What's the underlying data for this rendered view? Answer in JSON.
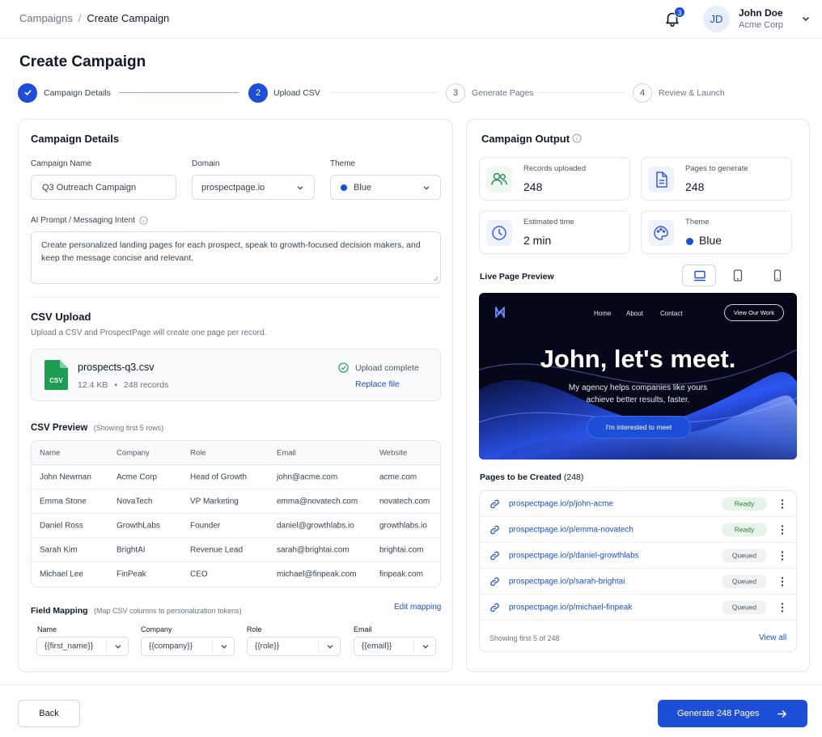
{
  "breadcrumb": {
    "parent": "Campaigns",
    "separator": "/",
    "current": "Create Campaign"
  },
  "header": {
    "notification_count": "3",
    "user_initials": "JD",
    "user_name": "John Doe",
    "user_org": "Acme Corp"
  },
  "page_title": "Create Campaign",
  "stepper": [
    {
      "number": "1",
      "label": "Campaign Details",
      "state": "done"
    },
    {
      "number": "2",
      "label": "Upload CSV",
      "state": "active"
    },
    {
      "number": "3",
      "label": "Generate Pages",
      "state": "todo"
    },
    {
      "number": "4",
      "label": "Review & Launch",
      "state": "todo"
    }
  ],
  "campaign_details": {
    "heading": "Campaign Details",
    "name_label": "Campaign Name",
    "name_value": "Q3 Outreach Campaign",
    "domain_label": "Domain",
    "domain_value": "prospectpage.io",
    "theme_label": "Theme",
    "theme_value": "Blue",
    "prompt_label": "AI Prompt / Messaging Intent",
    "prompt_value": "Create personalized landing pages for each prospect, speak to growth-focused decision makers, and keep the message concise and relevant."
  },
  "csv_upload": {
    "heading": "CSV Upload",
    "description": "Upload a CSV and ProspectPage will create one page per record.",
    "file_badge": "CSV",
    "file_name": "prospects-q3.csv",
    "file_size": "12.4 KB",
    "bullet": "•",
    "record_count": "248 records",
    "status": "Upload complete",
    "replace_label": "Replace file"
  },
  "csv_preview": {
    "heading": "CSV Preview",
    "note": "(Showing first 5 rows)",
    "columns": [
      "Name",
      "Company",
      "Role",
      "Email",
      "Website"
    ],
    "rows": [
      [
        "John Newman",
        "Acme Corp",
        "Head of Growth",
        "john@acme.com",
        "acme.com"
      ],
      [
        "Emma Stone",
        "NovaTech",
        "VP Marketing",
        "emma@novatech.com",
        "novatech.com"
      ],
      [
        "Daniel Ross",
        "GrowthLabs",
        "Founder",
        "daniel@growthlabs.io",
        "growthlabs.io"
      ],
      [
        "Sarah Kim",
        "BrightAI",
        "Revenue Lead",
        "sarah@brightai.com",
        "brightai.com"
      ],
      [
        "Michael Lee",
        "FinPeak",
        "CEO",
        "michael@finpeak.com",
        "finpeak.com"
      ]
    ]
  },
  "field_mapping": {
    "heading": "Field Mapping",
    "note": "(Map CSV columns to personalization tokens)",
    "edit_label": "Edit mapping",
    "fields": [
      {
        "label": "Name",
        "value": "{{first_name}}"
      },
      {
        "label": "Company",
        "value": "{{company}}"
      },
      {
        "label": "Role",
        "value": "{{role}}"
      },
      {
        "label": "Email",
        "value": "{{email}}"
      }
    ]
  },
  "output": {
    "heading": "Campaign Output",
    "stats": [
      {
        "label": "Records uploaded",
        "value": "248",
        "icon": "users-icon"
      },
      {
        "label": "Pages to generate",
        "value": "248",
        "icon": "document-icon"
      },
      {
        "label": "Estimated time",
        "value": "2 min",
        "icon": "clock-icon"
      },
      {
        "label": "Theme",
        "value": "Blue",
        "icon": "palette-icon"
      }
    ],
    "preview_label": "Live Page Preview",
    "preview": {
      "nav": [
        "Home",
        "About",
        "Contact"
      ],
      "nav_button": "View Our Work",
      "headline": "John, let's meet.",
      "subline_1": "My agency helps companies like yours",
      "subline_2": "achieve better results, faster.",
      "cta": "I'm interested to meet"
    },
    "pages_heading": "Pages to be Created",
    "pages_count": "(248)",
    "pages": [
      {
        "url": "prospectpage.io/p/john-acme",
        "status": "Ready"
      },
      {
        "url": "prospectpage.io/p/emma-novatech",
        "status": "Ready"
      },
      {
        "url": "prospectpage.io/p/daniel-growthlabs",
        "status": "Queued"
      },
      {
        "url": "prospectpage.io/p/sarah-brightai",
        "status": "Queued"
      },
      {
        "url": "prospectpage.io/p/michael-finpeak",
        "status": "Queued"
      }
    ],
    "pages_footer": "Showing first 5 of 248",
    "view_all": "View all"
  },
  "footer": {
    "back_label": "Back",
    "generate_label": "Generate 248 Pages"
  },
  "colors": {
    "accent": "#1d4ed8",
    "ready_bg": "#e7f4ea",
    "ready_text": "#2f7d3f",
    "csv_green": "#1f9d55"
  }
}
